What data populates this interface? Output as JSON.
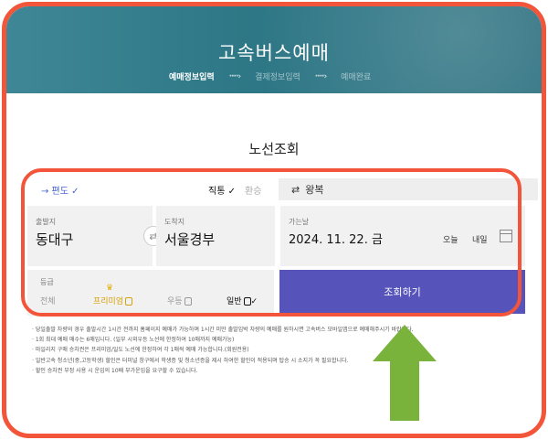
{
  "header": {
    "title": "고속버스예매",
    "steps": [
      {
        "label": "예매정보입력",
        "active": true
      },
      {
        "label": "결제정보입력",
        "active": false
      },
      {
        "label": "예매완료",
        "active": false
      }
    ],
    "step_arrow": "····›"
  },
  "section_title": "노선조회",
  "trip": {
    "oneway_label": "→ 편도 ✓",
    "direct_label": "직통 ✓",
    "transfer_label": "환승",
    "roundtrip_icon": "⇄",
    "roundtrip_label": "왕복"
  },
  "departure": {
    "label": "출발지",
    "value": "동대구"
  },
  "arrival": {
    "label": "도착지",
    "value": "서울경부"
  },
  "swap_icon": "⇄",
  "date": {
    "label": "가는날",
    "value": "2024. 11. 22. 금",
    "today": "오늘",
    "tomorrow": "내일"
  },
  "grade": {
    "label": "등급",
    "options": [
      {
        "label": "전체"
      },
      {
        "label": "프리미엄"
      },
      {
        "label": "우등"
      },
      {
        "label": "일반",
        "check": "✓"
      }
    ]
  },
  "search_button": "조회하기",
  "notes": [
    "· 당일출발 차량의 경우 출발시간 1시간 전까지 홈페이지 예매가 가능하며 1시간 미만 출발임박 차량의 예매를 원하시면 고속버스 모바일앱으로 예매해주시기 바랍니다.",
    "· 1회 최대 예매 매수는 6매입니다. (일부 시외우등 노선에 한정하여 10매까지 예매가능)",
    "· 마일리지 구매 승차권은 프리미엄/일도 노선에 한정하여 각 1매씩 예매 가능합니다.(회원전용)",
    "· 일반고속 청소년(중,고등학생) 할인은 터미널 창구에서 학생증 및 청소년증을 제시 하여한 할인이 적용되며 탑승 시 소지가 꼭 필요합니다.",
    "· 할인 승차권 부정 사용 시 운임의 10배 부가운임을 요구할 수 있습니다."
  ],
  "colors": {
    "frame": "#f2553a",
    "hero": "#2d7786",
    "accent": "#4a66d6",
    "search": "#5654bb",
    "arrow": "#7ab33c"
  }
}
